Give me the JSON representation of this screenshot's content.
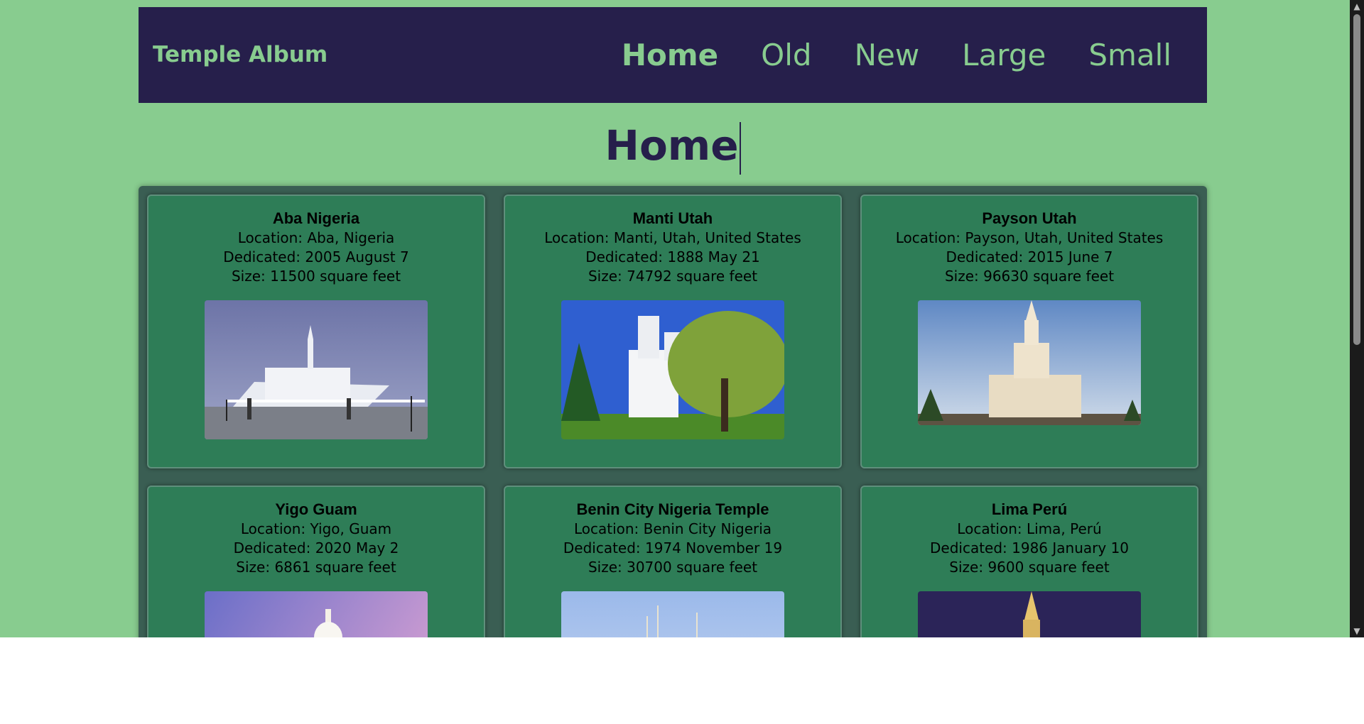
{
  "header": {
    "brand": "Temple Album",
    "nav": [
      {
        "label": "Home",
        "active": true
      },
      {
        "label": "Old",
        "active": false
      },
      {
        "label": "New",
        "active": false
      },
      {
        "label": "Large",
        "active": false
      },
      {
        "label": "Small",
        "active": false
      }
    ]
  },
  "main": {
    "title": "Home"
  },
  "temples": [
    {
      "name": "Aba Nigeria",
      "location": "Location: Aba, Nigeria",
      "dedicated": "Dedicated: 2005 August 7",
      "size": "Size: 11500 square feet"
    },
    {
      "name": "Manti Utah",
      "location": "Location: Manti, Utah, United States",
      "dedicated": "Dedicated: 1888 May 21",
      "size": "Size: 74792 square feet"
    },
    {
      "name": "Payson Utah",
      "location": "Location: Payson, Utah, United States",
      "dedicated": "Dedicated: 2015 June 7",
      "size": "Size: 96630 square feet"
    },
    {
      "name": "Yigo Guam",
      "location": "Location: Yigo, Guam",
      "dedicated": "Dedicated: 2020 May 2",
      "size": "Size: 6861 square feet"
    },
    {
      "name": "Benin City Nigeria Temple",
      "location": "Location: Benin City Nigeria",
      "dedicated": "Dedicated: 1974 November 19",
      "size": "Size: 30700 square feet"
    },
    {
      "name": "Lima Perú",
      "location": "Location: Lima, Perú",
      "dedicated": "Dedicated: 1986 January 10",
      "size": "Size: 9600 square feet"
    }
  ],
  "colors": {
    "background": "#88cc8f",
    "header": "#261f4b",
    "card": "#2e7d57",
    "grid_frame": "#3a5e53"
  }
}
